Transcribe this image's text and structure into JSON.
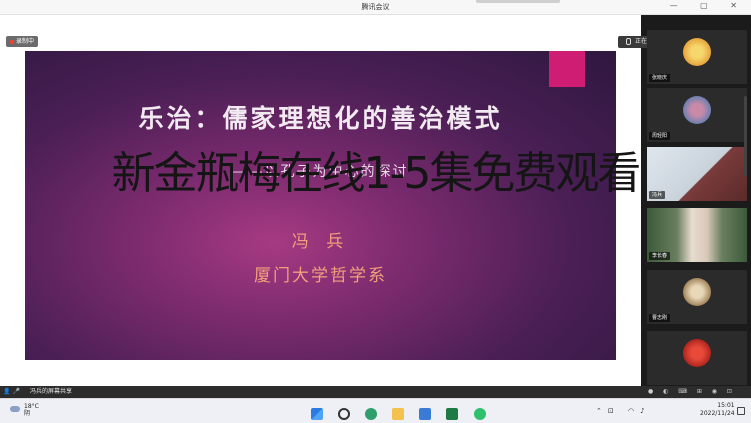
{
  "window": {
    "title": "腾讯会议",
    "controls": "— ▢ ✕"
  },
  "recording": {
    "label": "录制中"
  },
  "speaking": {
    "label": "正在讲话: 李长春"
  },
  "slide": {
    "title": "乐治：儒家理想化的善治模式",
    "subtitle": "——以孔子为中心的探讨",
    "author": "冯 兵",
    "institution": "厦门大学哲学系"
  },
  "overlay_text": "新金瓶梅在线1-5集免费观看",
  "participants": [
    {
      "name": "张晓庆"
    },
    {
      "name": "周轻阳"
    },
    {
      "name": "冯兵"
    },
    {
      "name": "李长春"
    },
    {
      "name": "曹志刚"
    },
    {
      "name": ""
    }
  ],
  "share_bar": {
    "label": "冯兵的屏幕共享"
  },
  "taskbar": {
    "weather_temp": "18°C",
    "weather_desc": "阴",
    "time": "15:01",
    "date": "2022/11/24"
  }
}
